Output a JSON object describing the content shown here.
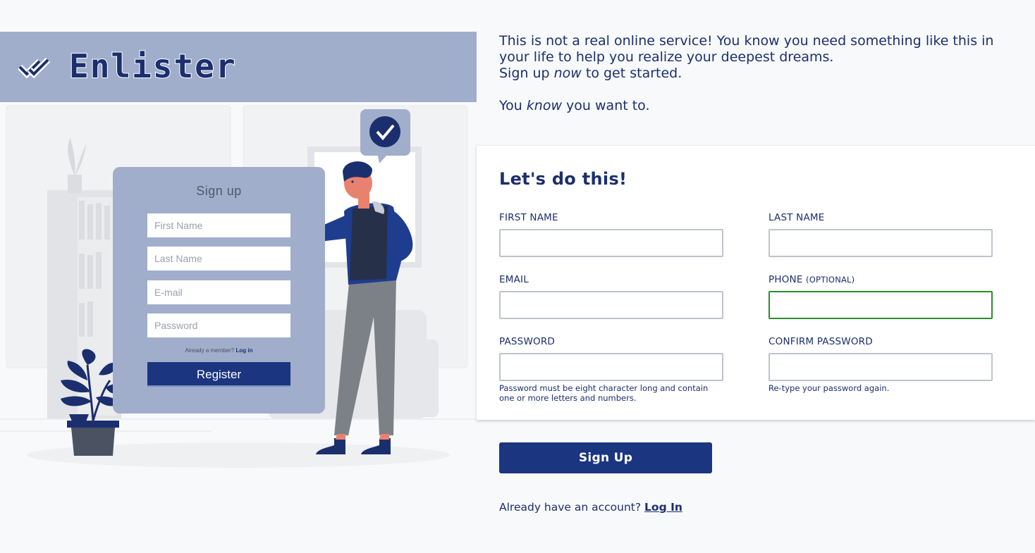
{
  "brand": {
    "name": "Enlister",
    "logo_icon": "double-check-icon",
    "bar_color": "#a1aecb",
    "accent": "#1b3580"
  },
  "illustration": {
    "title": "Sign up",
    "first_name_placeholder": "First Name",
    "last_name_placeholder": "Last Name",
    "email_placeholder": "E-mail",
    "password_placeholder": "Password",
    "already_member": "Already a member?",
    "login_link": "Log in",
    "register_label": "Register",
    "bubble_icon": "checkmark-bubble-icon"
  },
  "intro": {
    "line1": "This is not a real online service! You know you need something like this in your life to help you realize your deepest dreams.",
    "line2_pre": "Sign up ",
    "line2_em": "now",
    "line2_post": " to get started.",
    "line3_pre": "You ",
    "line3_em": "know",
    "line3_post": " you want to."
  },
  "form": {
    "heading": "Let's do this!",
    "first_name_label": "FIRST NAME",
    "last_name_label": "LAST NAME",
    "email_label": "EMAIL",
    "phone_label": "PHONE",
    "phone_optional": "(OPTIONAL)",
    "password_label": "PASSWORD",
    "password_help": "Password must be eight character long and contain one or more letters and numbers.",
    "confirm_label": "CONFIRM PASSWORD",
    "confirm_help": "Re-type your password again.",
    "first_name_value": "",
    "last_name_value": "",
    "email_value": "",
    "phone_value": "",
    "password_value": "",
    "confirm_value": "",
    "focus_color": "#2e8b2e"
  },
  "actions": {
    "signup_label": "Sign Up",
    "account_prompt": "Already have an account?",
    "login_label": "Log In"
  }
}
